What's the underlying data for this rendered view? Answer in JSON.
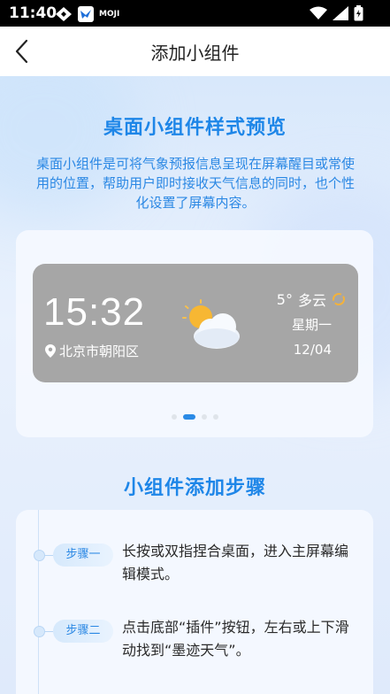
{
  "status_bar": {
    "time": "11:40",
    "app_badge": "MOJI"
  },
  "header": {
    "title": "添加小组件"
  },
  "preview_section": {
    "title": "桌面小组件样式预览",
    "intro": "桌面小组件是可将气象预报信息呈现在屏幕醒目或常使用的位置，帮助用户即时接收天气信息的同时，也个性化设置了屏幕内容。",
    "widget": {
      "time": "15:32",
      "location": "北京市朝阳区",
      "temperature": "5°",
      "condition": "多云",
      "weekday": "星期一",
      "date": "12/04"
    },
    "pager": {
      "total": 4,
      "active_index": 1
    }
  },
  "steps_section": {
    "title": "小组件添加步骤",
    "steps": [
      {
        "label": "步骤一",
        "text": "长按或双指捏合桌面，进入主屏幕编辑模式。"
      },
      {
        "label": "步骤二",
        "text": "点击底部“插件”按钮，左右或上下滑动找到“墨迹天气”。"
      }
    ]
  },
  "colors": {
    "accent": "#2a8ae6",
    "widget_bg": "#a6a6a6",
    "sun": "#f7b733"
  }
}
